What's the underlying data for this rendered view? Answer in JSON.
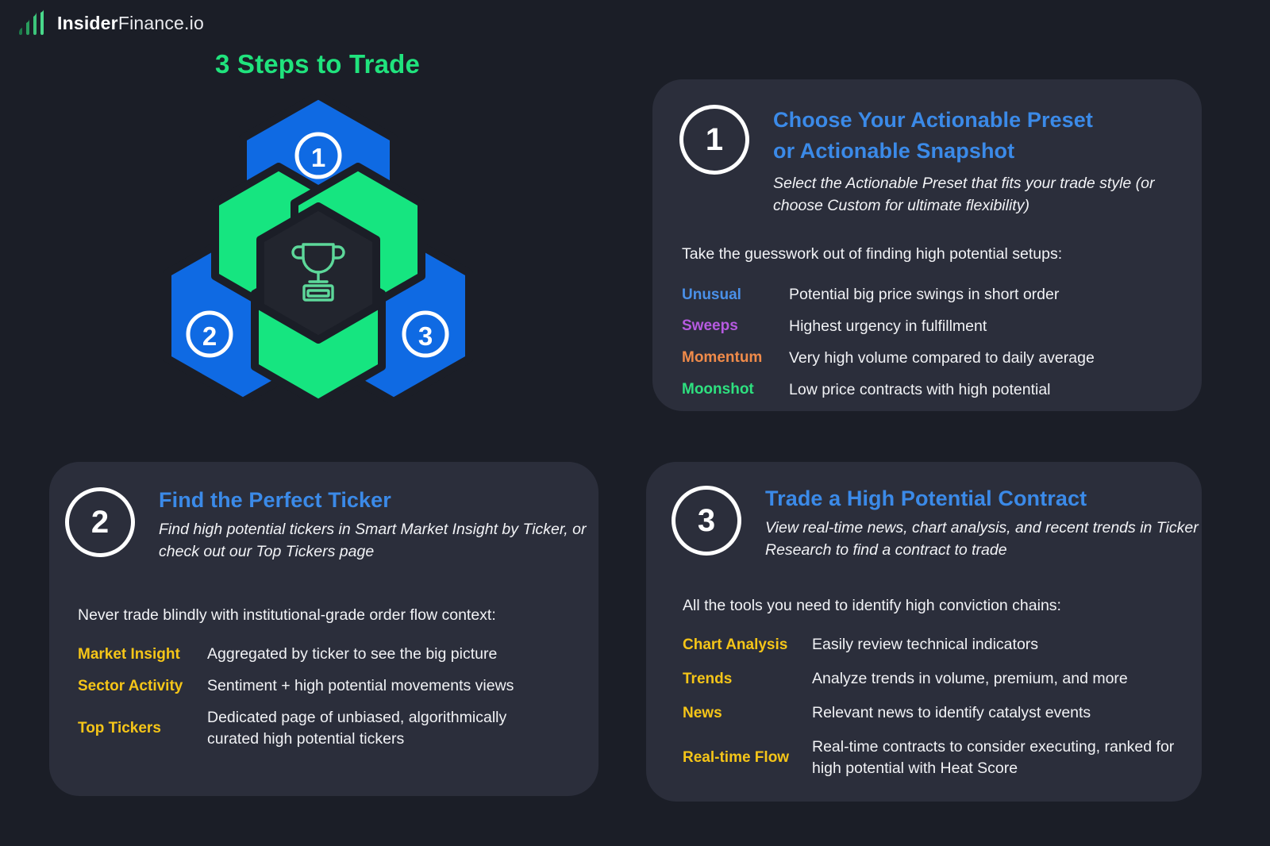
{
  "brand": {
    "name_bold": "Insider",
    "name_light": "Finance.io",
    "logo_icon": "bar-chart-icon",
    "accent_green": "#20e37d"
  },
  "headline": "3 Steps to Trade",
  "hex_graphic": {
    "center_icon": "trophy-icon",
    "blue": "#0f6ae3",
    "green": "#16e580",
    "dark": "#1b1e27",
    "nodes": [
      {
        "number": "1",
        "position": "top"
      },
      {
        "number": "2",
        "position": "bottom-left"
      },
      {
        "number": "3",
        "position": "bottom-right"
      }
    ]
  },
  "cards": [
    {
      "number": "1",
      "title_line1": "Choose Your Actionable Preset",
      "title_line2": "or Actionable Snapshot",
      "subtitle": "Select the Actionable Preset that fits your trade style (or choose Custom for ultimate flexibility)",
      "lead": "Take the guesswork out of finding high potential setups:",
      "rows": [
        {
          "label": "Unusual",
          "color": "#4a90e8",
          "desc": "Potential big price swings in short order"
        },
        {
          "label": "Sweeps",
          "color": "#b65ae0",
          "desc": "Highest urgency in fulfillment"
        },
        {
          "label": "Momentum",
          "color": "#f08b4a",
          "desc": "Very high volume compared to daily average"
        },
        {
          "label": "Moonshot",
          "color": "#2ee07f",
          "desc": "Low price contracts with high potential"
        }
      ]
    },
    {
      "number": "2",
      "title_line1": "Find the Perfect Ticker",
      "title_line2": "",
      "subtitle": "Find high potential tickers in Smart Market Insight by Ticker, or check out our Top Tickers page",
      "lead": "Never trade blindly with institutional-grade order flow context:",
      "rows": [
        {
          "label": "Market Insight",
          "color": "#f5c518",
          "desc": "Aggregated by ticker to see the big picture"
        },
        {
          "label": "Sector Activity",
          "color": "#f5c518",
          "desc": "Sentiment + high potential movements views"
        },
        {
          "label": "Top Tickers",
          "color": "#f5c518",
          "desc": "Dedicated page of unbiased, algorithmically curated high potential tickers"
        }
      ]
    },
    {
      "number": "3",
      "title_line1": "Trade a High Potential Contract",
      "title_line2": "",
      "subtitle": "View real-time news, chart analysis, and recent trends in Ticker Research to find a contract to trade",
      "lead": "All the tools you need to identify high conviction chains:",
      "rows": [
        {
          "label": "Chart Analysis",
          "color": "#f5c518",
          "desc": "Easily review technical indicators"
        },
        {
          "label": "Trends",
          "color": "#f5c518",
          "desc": "Analyze trends in volume, premium, and more"
        },
        {
          "label": "News",
          "color": "#f5c518",
          "desc": "Relevant news to identify catalyst events"
        },
        {
          "label": "Real-time Flow",
          "color": "#f5c518",
          "desc": "Real-time contracts to consider executing, ranked for high potential with Heat Score"
        }
      ]
    }
  ]
}
